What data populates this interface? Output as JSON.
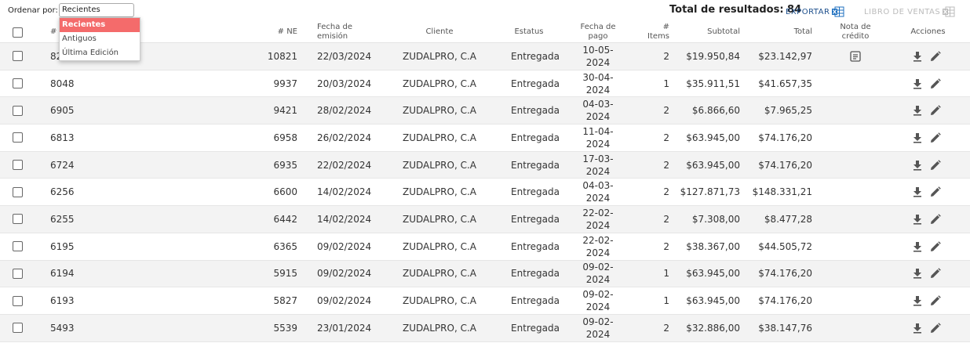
{
  "sort": {
    "label": "Ordenar por:",
    "value": "Recientes",
    "options": [
      "Recientes",
      "Antiguos",
      "Última Edición"
    ]
  },
  "summary": {
    "total_label": "Total de resultados: 84"
  },
  "actions": {
    "export_label": "EXPORTAR",
    "libro_label": "LIBRO DE VENTAS"
  },
  "colors": {
    "accent": "#f46b6b",
    "link": "#1d4f8c",
    "excel": "#1d6fbf"
  },
  "columns": {
    "num": "#",
    "ne": "# NE",
    "fecha_emision": "Fecha de emisión",
    "cliente": "Cliente",
    "estatus": "Estatus",
    "fecha_pago": "Fecha de pago",
    "items": "# Items",
    "subtotal": "Subtotal",
    "total": "Total",
    "nota": "Nota de crédito",
    "acciones": "Acciones"
  },
  "rows": [
    {
      "num": "8227",
      "ne": "10821",
      "emision": "22/03/2024",
      "cliente": "ZUDALPRO, C.A",
      "estatus": "Entregada",
      "pago": "10-05-2024",
      "items": "2",
      "subtotal": "$19.950,84",
      "total": "$23.142,97",
      "nota": true
    },
    {
      "num": "8048",
      "ne": "9937",
      "emision": "20/03/2024",
      "cliente": "ZUDALPRO, C.A",
      "estatus": "Entregada",
      "pago": "30-04-2024",
      "items": "1",
      "subtotal": "$35.911,51",
      "total": "$41.657,35",
      "nota": false
    },
    {
      "num": "6905",
      "ne": "9421",
      "emision": "28/02/2024",
      "cliente": "ZUDALPRO, C.A",
      "estatus": "Entregada",
      "pago": "04-03-2024",
      "items": "2",
      "subtotal": "$6.866,60",
      "total": "$7.965,25",
      "nota": false
    },
    {
      "num": "6813",
      "ne": "6958",
      "emision": "26/02/2024",
      "cliente": "ZUDALPRO, C.A",
      "estatus": "Entregada",
      "pago": "11-04-2024",
      "items": "2",
      "subtotal": "$63.945,00",
      "total": "$74.176,20",
      "nota": false
    },
    {
      "num": "6724",
      "ne": "6935",
      "emision": "22/02/2024",
      "cliente": "ZUDALPRO, C.A",
      "estatus": "Entregada",
      "pago": "17-03-2024",
      "items": "2",
      "subtotal": "$63.945,00",
      "total": "$74.176,20",
      "nota": false
    },
    {
      "num": "6256",
      "ne": "6600",
      "emision": "14/02/2024",
      "cliente": "ZUDALPRO, C.A",
      "estatus": "Entregada",
      "pago": "04-03-2024",
      "items": "2",
      "subtotal": "$127.871,73",
      "total": "$148.331,21",
      "nota": false
    },
    {
      "num": "6255",
      "ne": "6442",
      "emision": "14/02/2024",
      "cliente": "ZUDALPRO, C.A",
      "estatus": "Entregada",
      "pago": "22-02-2024",
      "items": "2",
      "subtotal": "$7.308,00",
      "total": "$8.477,28",
      "nota": false
    },
    {
      "num": "6195",
      "ne": "6365",
      "emision": "09/02/2024",
      "cliente": "ZUDALPRO, C.A",
      "estatus": "Entregada",
      "pago": "22-02-2024",
      "items": "2",
      "subtotal": "$38.367,00",
      "total": "$44.505,72",
      "nota": false
    },
    {
      "num": "6194",
      "ne": "5915",
      "emision": "09/02/2024",
      "cliente": "ZUDALPRO, C.A",
      "estatus": "Entregada",
      "pago": "09-02-2024",
      "items": "1",
      "subtotal": "$63.945,00",
      "total": "$74.176,20",
      "nota": false
    },
    {
      "num": "6193",
      "ne": "5827",
      "emision": "09/02/2024",
      "cliente": "ZUDALPRO, C.A",
      "estatus": "Entregada",
      "pago": "09-02-2024",
      "items": "1",
      "subtotal": "$63.945,00",
      "total": "$74.176,20",
      "nota": false
    },
    {
      "num": "5493",
      "ne": "5539",
      "emision": "23/01/2024",
      "cliente": "ZUDALPRO, C.A",
      "estatus": "Entregada",
      "pago": "09-02-2024",
      "items": "2",
      "subtotal": "$32.886,00",
      "total": "$38.147,76",
      "nota": false
    }
  ]
}
